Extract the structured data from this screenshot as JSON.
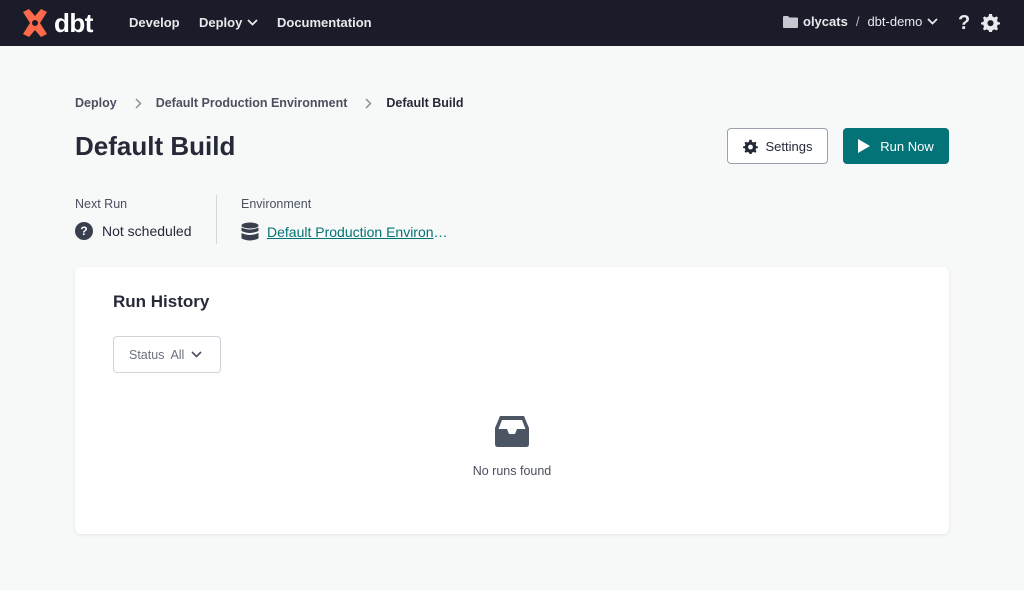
{
  "topbar": {
    "logo_text": "dbt",
    "nav": [
      {
        "label": "Develop"
      },
      {
        "label": "Deploy"
      },
      {
        "label": "Documentation"
      }
    ],
    "account": {
      "name": "olycats",
      "separator": "/",
      "project": "dbt-demo"
    },
    "help_label": "?"
  },
  "breadcrumb": [
    "Deploy",
    "Default Production Environment",
    "Default Build"
  ],
  "page": {
    "title": "Default Build",
    "settings_label": "Settings",
    "run_label": "Run Now"
  },
  "meta": {
    "next_run_label": "Next Run",
    "next_run_value": "Not scheduled",
    "environment_label": "Environment",
    "environment_value": "Default Production Environment"
  },
  "run_history": {
    "title": "Run History",
    "filter_label": "Status",
    "filter_value": "All",
    "empty_text": "No runs found"
  },
  "colors": {
    "topbar": "#1a1d29",
    "brand_orange": "#ff694b",
    "accent_teal": "#047377",
    "background": "#f7f8f8"
  },
  "icons": [
    "dbt-logo-icon",
    "chevron-down-icon",
    "folder-icon",
    "help-icon",
    "gear-icon",
    "play-icon",
    "question-circle-icon",
    "database-icon",
    "inbox-icon"
  ]
}
